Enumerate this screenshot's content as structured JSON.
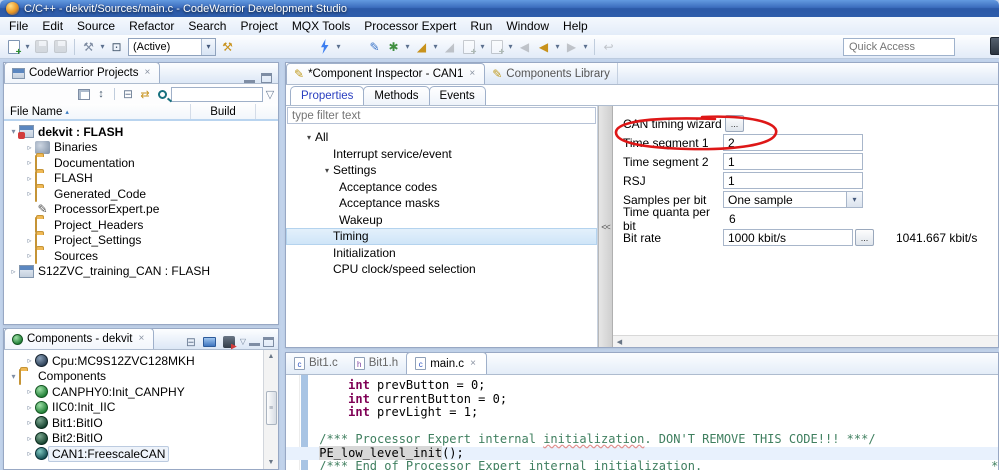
{
  "window": {
    "title": "C/C++ - dekvit/Sources/main.c - CodeWarrior Development Studio"
  },
  "menubar": {
    "items": [
      "File",
      "Edit",
      "Source",
      "Refactor",
      "Search",
      "Project",
      "MQX Tools",
      "Processor Expert",
      "Run",
      "Window",
      "Help"
    ]
  },
  "toolbar": {
    "active_config": "(Active)",
    "quick_access_placeholder": "Quick Access"
  },
  "projects": {
    "tab": "CodeWarrior Projects",
    "columns": {
      "file_name": "File Name",
      "build": "Build"
    },
    "tree": [
      {
        "exp": "▾",
        "label": "dekvit : FLASH"
      },
      {
        "exp": "▹",
        "label": "Binaries"
      },
      {
        "exp": "▹",
        "label": "Documentation"
      },
      {
        "exp": "▹",
        "label": "FLASH"
      },
      {
        "exp": "▹",
        "label": "Generated_Code"
      },
      {
        "exp": "",
        "label": "ProcessorExpert.pe"
      },
      {
        "exp": "",
        "label": "Project_Headers"
      },
      {
        "exp": "▹",
        "label": "Project_Settings"
      },
      {
        "exp": "▹",
        "label": "Sources"
      },
      {
        "exp": "▹",
        "label": "S12ZVC_training_CAN : FLASH"
      }
    ]
  },
  "components": {
    "tab": "Components - dekvit",
    "tree": [
      {
        "exp": "▹",
        "label": "Cpu:MC9S12ZVC128MKH"
      },
      {
        "exp": "▾",
        "label": "Components"
      },
      {
        "exp": "▹",
        "label": "CANPHY0:Init_CANPHY"
      },
      {
        "exp": "▹",
        "label": "IIC0:Init_IIC"
      },
      {
        "exp": "▹",
        "label": "Bit1:BitIO"
      },
      {
        "exp": "▹",
        "label": "Bit2:BitIO"
      },
      {
        "exp": "▹",
        "label": "CAN1:FreescaleCAN"
      }
    ]
  },
  "inspector": {
    "tab_active": "*Component Inspector - CAN1",
    "tab_library": "Components Library",
    "subtabs": [
      "Properties",
      "Methods",
      "Events"
    ],
    "filter_placeholder": "type filter text",
    "collapse_label": "<<",
    "tree": [
      {
        "exp": "▾",
        "label": "All"
      },
      {
        "exp": "",
        "label": "Interrupt service/event"
      },
      {
        "exp": "▾",
        "label": "Settings"
      },
      {
        "exp": "",
        "label": "Acceptance codes"
      },
      {
        "exp": "",
        "label": "Acceptance masks"
      },
      {
        "exp": "",
        "label": "Wakeup"
      },
      {
        "exp": "",
        "label": "Timing"
      },
      {
        "exp": "",
        "label": "Initialization"
      },
      {
        "exp": "",
        "label": "CPU clock/speed selection"
      }
    ],
    "props": {
      "wizard_label": "CAN timing wizard",
      "wizard_button": "...",
      "seg1_label": "Time segment 1",
      "seg1_value": "2",
      "seg2_label": "Time segment 2",
      "seg2_value": "1",
      "rsj_label": "RSJ",
      "rsj_value": "1",
      "samples_label": "Samples per bit",
      "samples_value": "One sample",
      "quanta_label": "Time quanta per bit",
      "quanta_value": "6",
      "bitrate_label": "Bit rate",
      "bitrate_value": "1000 kbit/s",
      "bitrate_button": "...",
      "bitrate_actual": "1041.667 kbit/s"
    }
  },
  "editor": {
    "tabs": [
      {
        "label": "Bit1.c"
      },
      {
        "label": "Bit1.h"
      },
      {
        "label": "main.c"
      }
    ],
    "code": {
      "ind_int": "     ",
      "ind_c": " ",
      "kw": "int",
      "l1": " prevButton = 0;",
      "l2": " currentButton = 0;",
      "l3": " prevLight = 1;",
      "c1a": "/*** Processor Expert internal ",
      "c1w": "initialization",
      "c1b": ". DON'T REMOVE THIS CODE!!! ***/",
      "fn": "PE_low_level_init",
      "fnb": "();",
      "c2a": "/*** End of Processor Expert internal ",
      "c2w": "initialization",
      "c2b": ".                                        ***/"
    }
  }
}
